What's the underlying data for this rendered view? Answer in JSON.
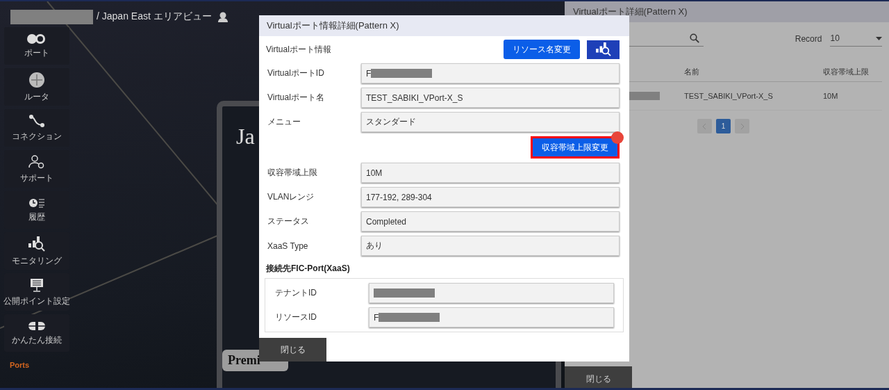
{
  "header": {
    "breadcrumb_redacted": true,
    "title": "/ Japan East エリアビュー"
  },
  "sidebar": {
    "items": [
      {
        "label": "ポート",
        "kind": "port"
      },
      {
        "label": "ルータ",
        "kind": "router"
      },
      {
        "label": "コネクション",
        "kind": "connection"
      },
      {
        "label": "サポート",
        "kind": "support"
      },
      {
        "label": "履歴",
        "kind": "history"
      },
      {
        "label": "モニタリング",
        "kind": "monitoring"
      },
      {
        "label": "公開ポイント設定",
        "kind": "public"
      },
      {
        "label": "かんたん接続",
        "kind": "easy"
      }
    ],
    "footer_label": "Ports"
  },
  "background_card": {
    "title": "Ja",
    "badge": "Premi"
  },
  "drawer": {
    "title": "Virtualポート詳細(Pattern X)",
    "record_label": "Record",
    "record_value": "10",
    "table": {
      "columns": [
        "名前",
        "収容帯域上限"
      ],
      "rows": [
        {
          "id_redacted": true,
          "name": "TEST_SABIKI_VPort-X_S",
          "bandwidth": "10M"
        }
      ]
    },
    "pagination": {
      "pages": [
        {
          "label": "1",
          "selected": true
        }
      ]
    },
    "close_button": "閉じる"
  },
  "modal": {
    "title": "Virtualポート情報詳細(Pattern X)",
    "section_title": "Virtualポート情報",
    "rename_button": "リソース名変更",
    "fields": [
      {
        "label": "VirtualポートID",
        "value": "F",
        "redacted": true
      },
      {
        "label": "Virtualポート名",
        "value": "TEST_SABIKI_VPort-X_S",
        "redacted": false
      },
      {
        "label": "メニュー",
        "value": "スタンダード",
        "redacted": false
      }
    ],
    "bandwidth_button": {
      "label": "収容帯域上限変更",
      "highlighted": true
    },
    "fields_2": [
      {
        "label": "収容帯域上限",
        "value": "10M",
        "redacted": false
      },
      {
        "label": "VLANレンジ",
        "value": "177-192, 289-304",
        "redacted": false
      },
      {
        "label": "ステータス",
        "value": "Completed",
        "redacted": false
      },
      {
        "label": "XaaS Type",
        "value": "あり",
        "redacted": false
      }
    ],
    "connection": {
      "title": "接続先FIC-Port(XaaS)",
      "fields": [
        {
          "label": "テナントID",
          "redacted": true
        },
        {
          "label": "リソースID",
          "value": "F",
          "redacted": true
        }
      ]
    },
    "close_button": "閉じる"
  }
}
